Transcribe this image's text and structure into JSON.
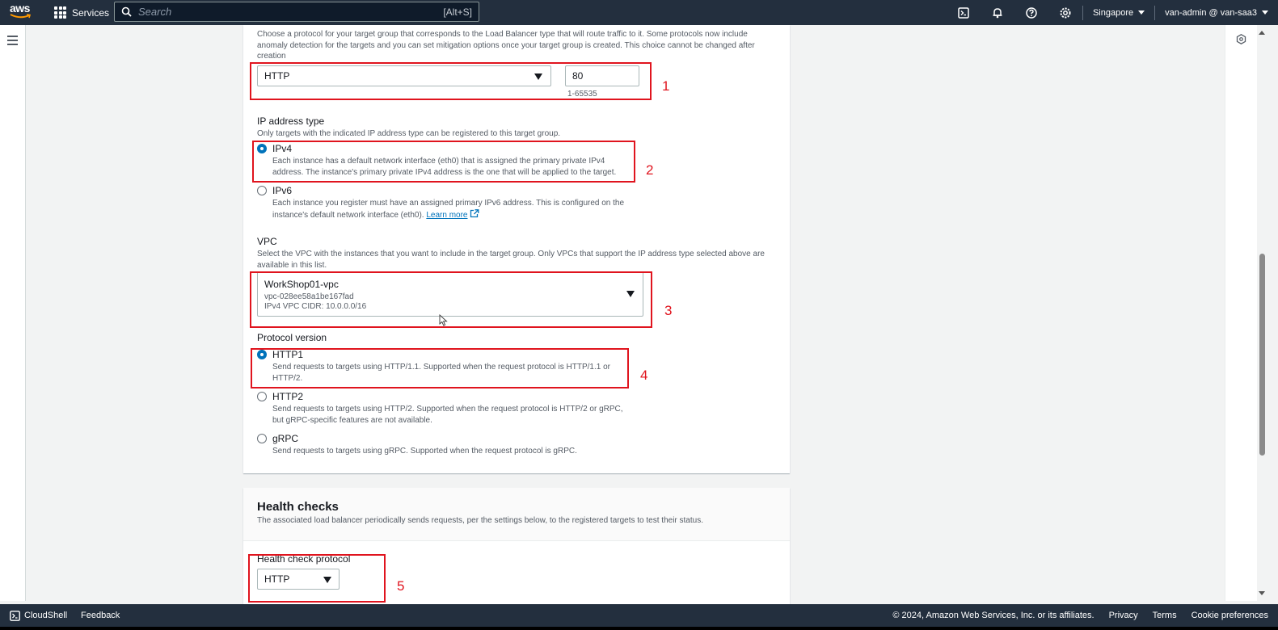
{
  "nav": {
    "logo_text": "aws",
    "services_label": "Services",
    "search_placeholder": "Search",
    "search_shortcut": "[Alt+S]",
    "region": "Singapore",
    "account": "van-admin @ van-saa3",
    "icons": [
      "cloudshell-icon",
      "bell-icon",
      "help-icon",
      "settings-icon"
    ]
  },
  "protocol_section": {
    "description": "Choose a protocol for your target group that corresponds to the Load Balancer type that will route traffic to it. Some protocols now include anomaly detection for the targets and you can set mitigation options once your target group is created. This choice cannot be changed after creation",
    "protocol_value": "HTTP",
    "port_value": "80",
    "port_hint": "1-65535"
  },
  "ip_section": {
    "title": "IP address type",
    "description": "Only targets with the indicated IP address type can be registered to this target group.",
    "options": [
      {
        "label": "IPv4",
        "selected": true,
        "description": "Each instance has a default network interface (eth0) that is assigned the primary private IPv4 address. The instance's primary private IPv4 address is the one that will be applied to the target."
      },
      {
        "label": "IPv6",
        "selected": false,
        "description": "Each instance you register must have an assigned primary IPv6 address. This is configured on the instance's default network interface (eth0).",
        "link": "Learn more"
      }
    ]
  },
  "vpc_section": {
    "title": "VPC",
    "description": "Select the VPC with the instances that you want to include in the target group. Only VPCs that support the IP address type selected above are available in this list.",
    "vpc_name": "WorkShop01-vpc",
    "vpc_id": "vpc-028ee58a1be167fad",
    "vpc_cidr": "IPv4 VPC CIDR: 10.0.0.0/16"
  },
  "protocol_version": {
    "title": "Protocol version",
    "options": [
      {
        "label": "HTTP1",
        "selected": true,
        "description": "Send requests to targets using HTTP/1.1. Supported when the request protocol is HTTP/1.1 or HTTP/2."
      },
      {
        "label": "HTTP2",
        "selected": false,
        "description": "Send requests to targets using HTTP/2. Supported when the request protocol is HTTP/2 or gRPC, but gRPC-specific features are not available."
      },
      {
        "label": "gRPC",
        "selected": false,
        "description": "Send requests to targets using gRPC. Supported when the request protocol is gRPC."
      }
    ]
  },
  "health_checks": {
    "title": "Health checks",
    "description": "The associated load balancer periodically sends requests, per the settings below, to the registered targets to test their status.",
    "protocol_label": "Health check protocol",
    "protocol_value": "HTTP"
  },
  "annotations": [
    "1",
    "2",
    "3",
    "4",
    "5"
  ],
  "annotation_color": "#e0141e",
  "footer": {
    "cloudshell": "CloudShell",
    "feedback": "Feedback",
    "copyright": "© 2024, Amazon Web Services, Inc. or its affiliates.",
    "links": [
      "Privacy",
      "Terms",
      "Cookie preferences"
    ]
  }
}
